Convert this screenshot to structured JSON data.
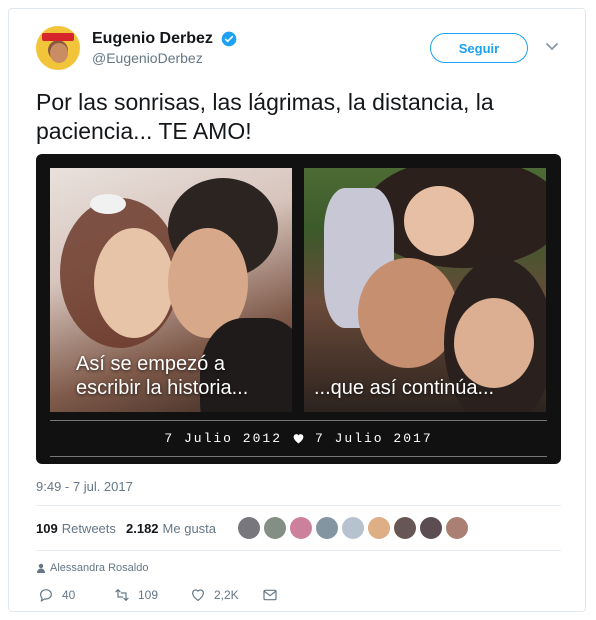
{
  "user": {
    "display_name": "Eugenio Derbez",
    "handle": "@EugenioDerbez",
    "verified": true
  },
  "follow_label": "Seguir",
  "tweet_text": "Por las sonrisas, las lágrimas, la distancia, la paciencia... TE AMO!",
  "media": {
    "caption_left": "Así se empezó a escribir la historia...",
    "caption_right": "...que así continúa...",
    "date_left": "7 Julio 2012",
    "date_right": "7 Julio 2017"
  },
  "timestamp": "9:49 - 7 jul. 2017",
  "stats": {
    "retweets_count": "109",
    "retweets_label": "Retweets",
    "likes_count": "2.182",
    "likes_label": "Me gusta"
  },
  "liker_colors": [
    "#5f5f66",
    "#6d7a6f",
    "#c36a8a",
    "#6d8290",
    "#a9b7c4",
    "#d8a070",
    "#4c3a36",
    "#3e2e33",
    "#9a6a5a"
  ],
  "reply_context": "Alessandra Rosaldo",
  "actions": {
    "reply_count": "40",
    "retweet_count": "109",
    "like_count": "2,2K"
  },
  "colors": {
    "accent": "#1da1f2",
    "secondary_text": "#657786"
  }
}
